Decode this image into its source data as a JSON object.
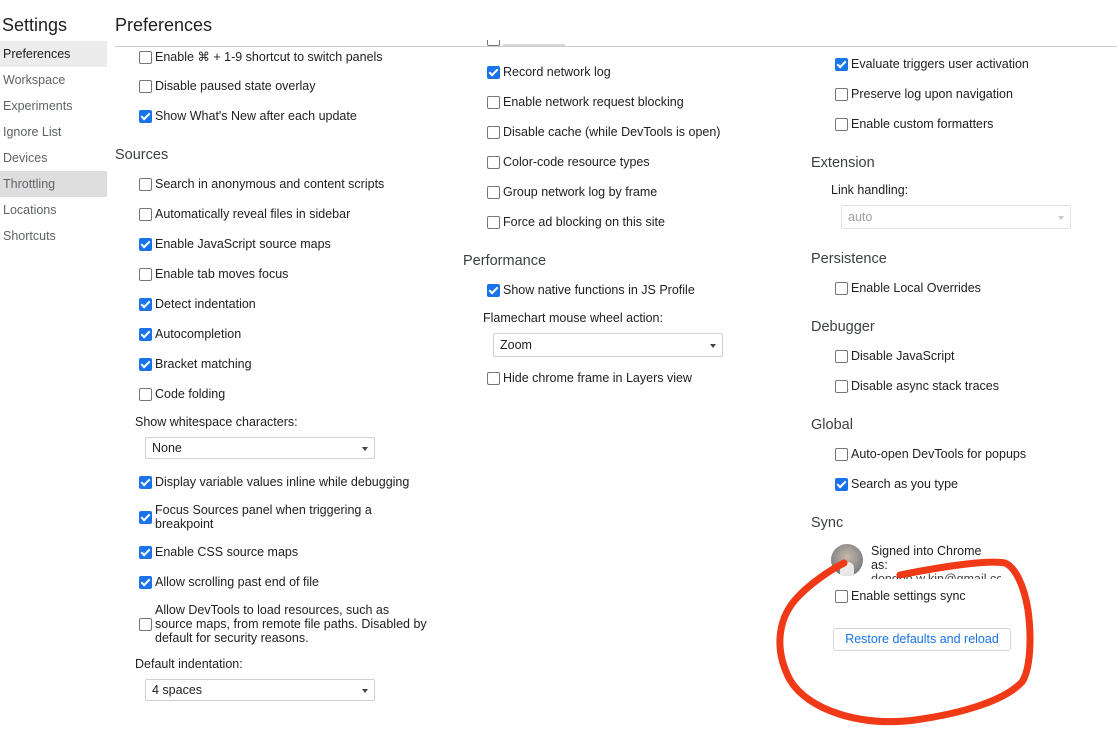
{
  "sidebar": {
    "title": "Settings",
    "items": [
      "Preferences",
      "Workspace",
      "Experiments",
      "Ignore List",
      "Devices",
      "Throttling",
      "Locations",
      "Shortcuts"
    ]
  },
  "main": {
    "title": "Preferences"
  },
  "col1": {
    "top_checkboxes": [
      {
        "label": "Enable ⌘ + 1-9 shortcut to switch panels",
        "checked": false
      },
      {
        "label": "Disable paused state overlay",
        "checked": false
      },
      {
        "label": "Show What's New after each update",
        "checked": true
      }
    ],
    "sources_title": "Sources",
    "sources_checkboxes": [
      {
        "label": "Search in anonymous and content scripts",
        "checked": false
      },
      {
        "label": "Automatically reveal files in sidebar",
        "checked": false
      },
      {
        "label": "Enable JavaScript source maps",
        "checked": true
      },
      {
        "label": "Enable tab moves focus",
        "checked": false
      },
      {
        "label": "Detect indentation",
        "checked": true
      },
      {
        "label": "Autocompletion",
        "checked": true
      },
      {
        "label": "Bracket matching",
        "checked": true
      },
      {
        "label": "Code folding",
        "checked": false
      }
    ],
    "whitespace_label": "Show whitespace characters:",
    "whitespace_value": "None",
    "more_checkboxes": [
      {
        "label": "Display variable values inline while debugging",
        "checked": true
      },
      {
        "label": "Focus Sources panel when triggering a breakpoint",
        "checked": true
      },
      {
        "label": "Enable CSS source maps",
        "checked": true
      },
      {
        "label": "Allow scrolling past end of file",
        "checked": true
      },
      {
        "label": "Allow DevTools to load resources, such as source maps, from remote file paths. Disabled by default for security reasons.",
        "checked": false
      }
    ],
    "indent_label": "Default indentation:",
    "indent_value": "4 spaces"
  },
  "col2": {
    "network_checkboxes": [
      {
        "label": "Record network log",
        "checked": true
      },
      {
        "label": "Enable network request blocking",
        "checked": false
      },
      {
        "label": "Disable cache (while DevTools is open)",
        "checked": false
      },
      {
        "label": "Color-code resource types",
        "checked": false
      },
      {
        "label": "Group network log by frame",
        "checked": false
      },
      {
        "label": "Force ad blocking on this site",
        "checked": false
      }
    ],
    "performance_title": "Performance",
    "native_functions": {
      "label": "Show native functions in JS Profile",
      "checked": true
    },
    "flamechart_label": "Flamechart mouse wheel action:",
    "flamechart_value": "Zoom",
    "hide_chrome_frame": {
      "label": "Hide chrome frame in Layers view",
      "checked": false
    }
  },
  "col3": {
    "console_checkboxes": [
      {
        "label": "Evaluate triggers user activation",
        "checked": true
      },
      {
        "label": "Preserve log upon navigation",
        "checked": false
      },
      {
        "label": "Enable custom formatters",
        "checked": false
      }
    ],
    "extension_title": "Extension",
    "link_handling_label": "Link handling:",
    "link_handling_value": "auto",
    "persistence_title": "Persistence",
    "local_overrides": {
      "label": "Enable Local Overrides",
      "checked": false
    },
    "debugger_title": "Debugger",
    "debugger_checkboxes": [
      {
        "label": "Disable JavaScript",
        "checked": false
      },
      {
        "label": "Disable async stack traces",
        "checked": false
      }
    ],
    "global_title": "Global",
    "global_checkboxes": [
      {
        "label": "Auto-open DevTools for popups",
        "checked": false
      },
      {
        "label": "Search as you type",
        "checked": true
      }
    ],
    "sync_title": "Sync",
    "signed_in": "Signed into Chrome as:",
    "signed_email": "dongbo.w.kin@gmail.com",
    "settings_sync": {
      "label": "Enable settings sync",
      "checked": false
    },
    "restore_button": "Restore defaults and reload"
  },
  "annotation_color": "#f03a17"
}
